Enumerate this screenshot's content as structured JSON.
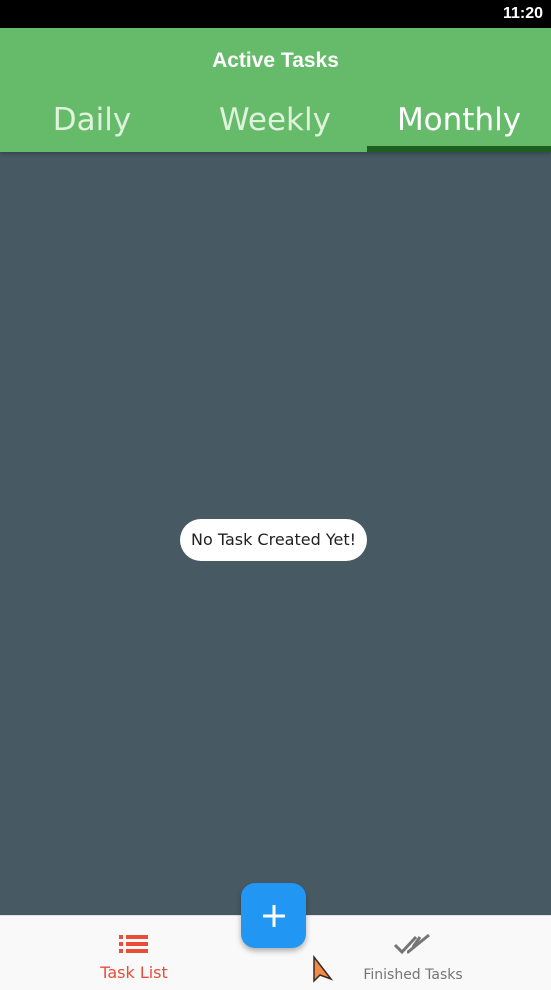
{
  "status_bar": {
    "time": "11:20"
  },
  "app_bar": {
    "title": "Active Tasks",
    "tabs": [
      {
        "label": "Daily",
        "selected": false
      },
      {
        "label": "Weekly",
        "selected": false
      },
      {
        "label": "Monthly",
        "selected": true
      }
    ]
  },
  "main": {
    "empty_message": "No Task Created Yet!"
  },
  "fab": {
    "icon": "plus-icon"
  },
  "bottom_nav": {
    "items": [
      {
        "label": "Task List",
        "icon": "list-icon",
        "active": true
      },
      {
        "label": "Finished Tasks",
        "icon": "double-check-icon",
        "active": false
      }
    ]
  },
  "colors": {
    "app_bar": "#66bb6a",
    "tab_indicator": "#1b5e20",
    "content_background": "#475a64",
    "fab": "#2196f3",
    "active_nav": "#ea4d36",
    "inactive_nav": "#757575"
  }
}
